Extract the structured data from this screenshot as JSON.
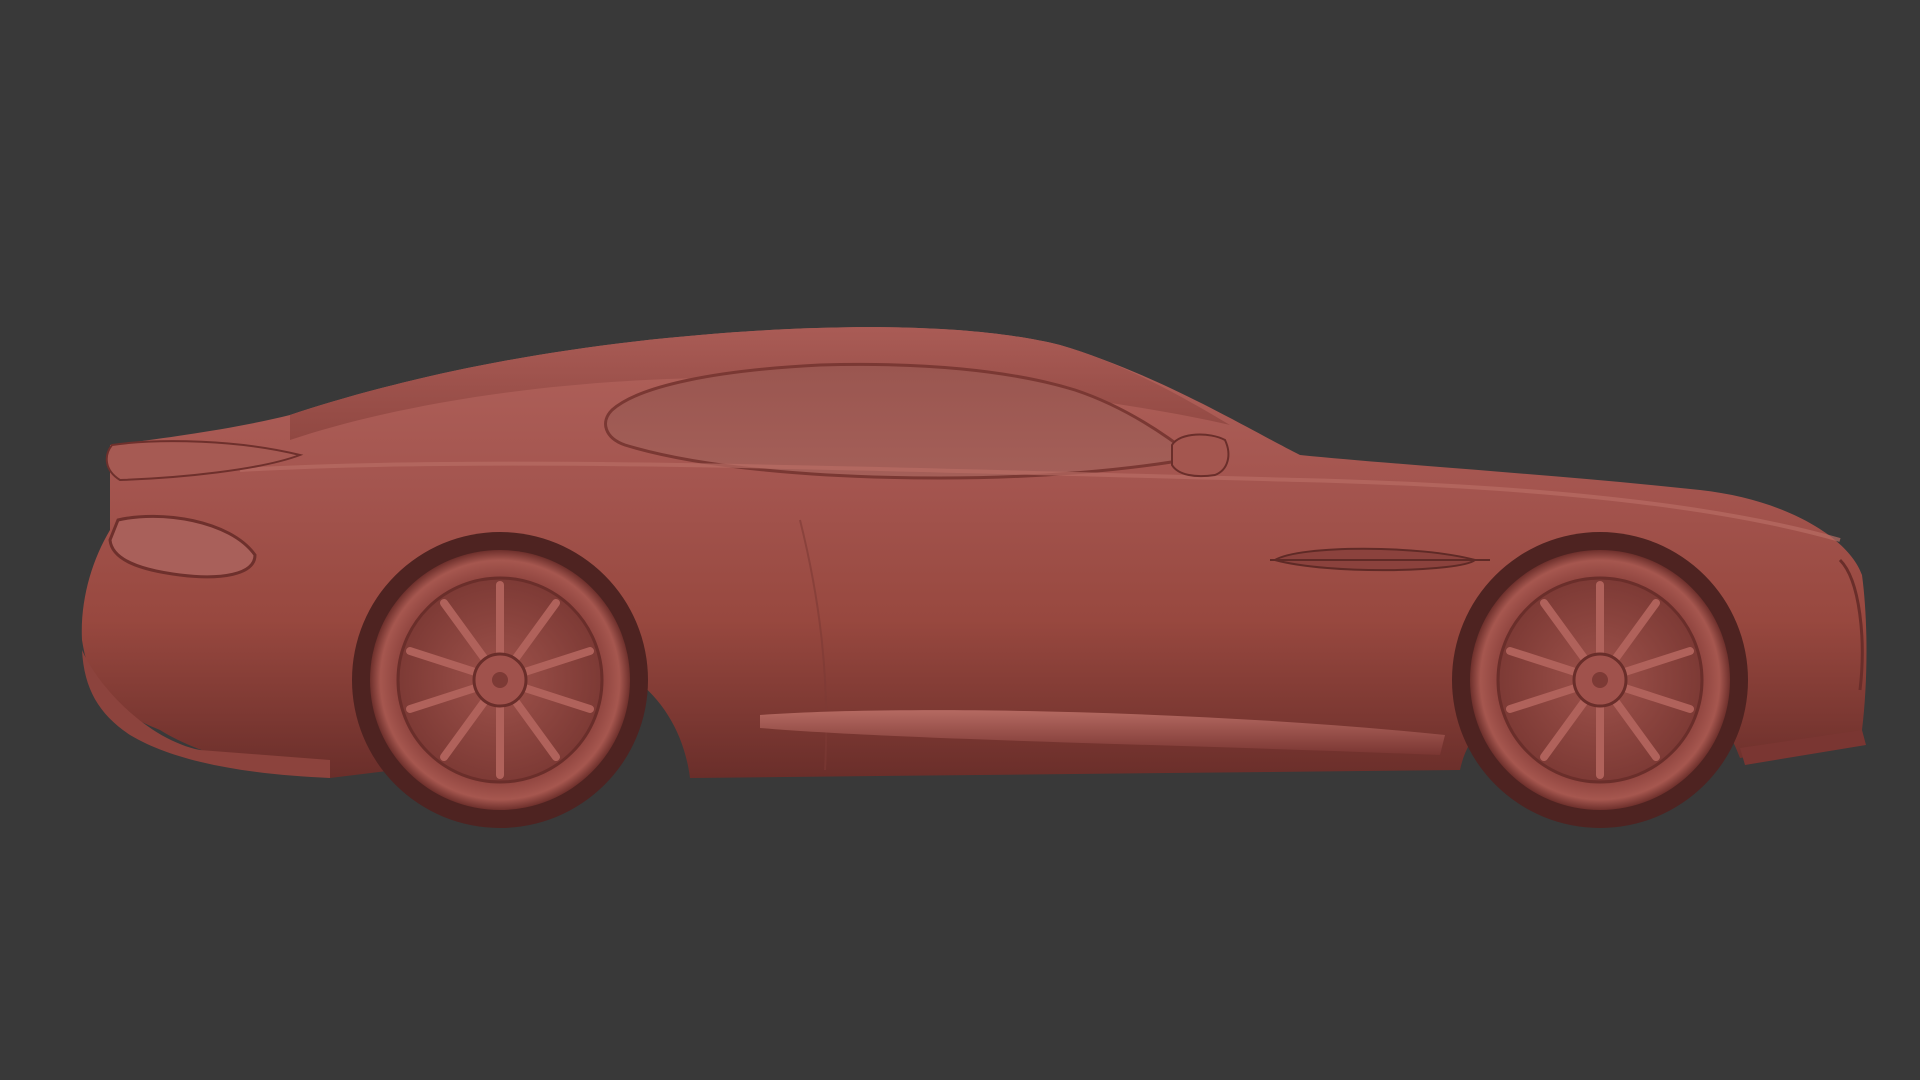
{
  "viewport": {
    "background_color": "#393939",
    "content": "car-model-side-view"
  },
  "model": {
    "material_color": "#a0524c",
    "material_highlight": "#c07670",
    "material_shadow": "#5e2a27",
    "view": "side-profile-right",
    "shading": "solid-clay"
  }
}
